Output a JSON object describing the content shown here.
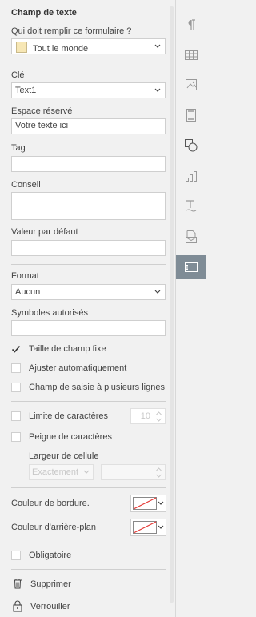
{
  "panel": {
    "title": "Champ de texte",
    "who_fill_label": "Qui doit remplir ce formulaire ?",
    "who_fill_value": "Tout le monde",
    "who_fill_color": "#f7e7b5",
    "key_label": "Clé",
    "key_value": "Text1",
    "placeholder_label": "Espace réservé",
    "placeholder_value": "Votre texte ici",
    "tag_label": "Tag",
    "tag_value": "",
    "tip_label": "Conseil",
    "tip_value": "",
    "default_label": "Valeur par défaut",
    "default_value": "",
    "format_label": "Format",
    "format_value": "Aucun",
    "allowed_symbols_label": "Symboles autorisés",
    "allowed_symbols_value": "",
    "fixed_size_label": "Taille de champ fixe",
    "autofit_label": "Ajuster automatiquement",
    "multiline_label": "Champ de saisie à plusieurs lignes",
    "char_limit_label": "Limite de caractères",
    "char_limit_value": "10",
    "comb_label": "Peigne de caractères",
    "cell_width_label": "Largeur de cellule",
    "cell_width_mode": "Exactement",
    "cell_width_value": "",
    "border_color_label": "Couleur de bordure.",
    "bg_color_label": "Couleur d'arrière-plan",
    "required_label": "Obligatoire",
    "delete_label": "Supprimer",
    "lock_label": "Verrouiller"
  },
  "rightbar": {
    "items": [
      "paragraph-icon",
      "table-icon",
      "image-icon",
      "header-footer-icon",
      "shape-icon",
      "chart-icon",
      "text-art-icon",
      "mail-merge-icon",
      "form-field-icon"
    ],
    "active": "form-field-icon"
  }
}
